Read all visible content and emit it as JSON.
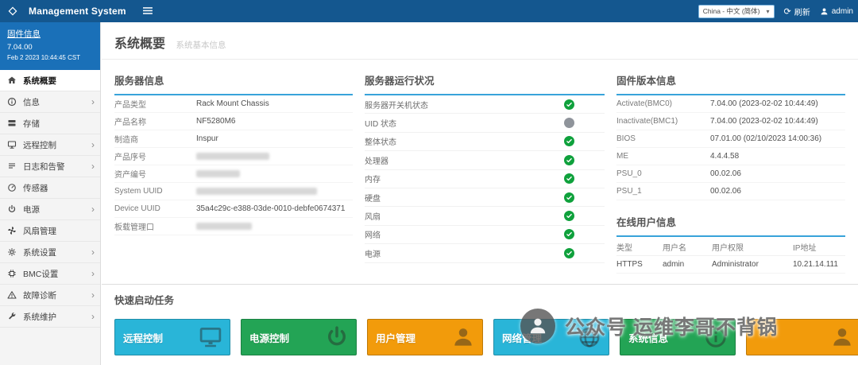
{
  "header": {
    "title": "Management System",
    "language": "China - 中文 (简体)",
    "refresh_label": "刷新",
    "user": "admin"
  },
  "sidebar": {
    "firmware_box": {
      "title": "固件信息",
      "version": "7.04.00",
      "date": "Feb 2 2023 10:44:45 CST"
    },
    "items": [
      {
        "id": "overview",
        "label": "系统概要",
        "icon": "home-icon",
        "active": true,
        "expandable": false
      },
      {
        "id": "info",
        "label": "信息",
        "icon": "info-icon",
        "active": false,
        "expandable": true
      },
      {
        "id": "storage",
        "label": "存储",
        "icon": "storage-icon",
        "active": false,
        "expandable": false
      },
      {
        "id": "remote-control",
        "label": "远程控制",
        "icon": "remote-icon",
        "active": false,
        "expandable": true
      },
      {
        "id": "logs-alerts",
        "label": "日志和告警",
        "icon": "log-icon",
        "active": false,
        "expandable": true
      },
      {
        "id": "sensors",
        "label": "传感器",
        "icon": "sensor-icon",
        "active": false,
        "expandable": false
      },
      {
        "id": "power",
        "label": "电源",
        "icon": "power-icon",
        "active": false,
        "expandable": true
      },
      {
        "id": "fan-management",
        "label": "风扇管理",
        "icon": "fan-icon",
        "active": false,
        "expandable": false
      },
      {
        "id": "system-settings",
        "label": "系统设置",
        "icon": "settings-icon",
        "active": false,
        "expandable": true
      },
      {
        "id": "bmc-settings",
        "label": "BMC设置",
        "icon": "bmc-icon",
        "active": false,
        "expandable": true
      },
      {
        "id": "fault-diagnosis",
        "label": "故障诊断",
        "icon": "diagnosis-icon",
        "active": false,
        "expandable": true
      },
      {
        "id": "system-maintenance",
        "label": "系统维护",
        "icon": "maintenance-icon",
        "active": false,
        "expandable": true
      }
    ]
  },
  "page": {
    "title": "系统概要",
    "subtitle": "系统基本信息"
  },
  "server_info": {
    "title": "服务器信息",
    "rows": [
      {
        "label": "产品类型",
        "value": "Rack Mount Chassis",
        "redacted": false
      },
      {
        "label": "产品名称",
        "value": "NF5280M6",
        "redacted": false
      },
      {
        "label": "制造商",
        "value": "Inspur",
        "redacted": false
      },
      {
        "label": "产品序号",
        "value": "",
        "redacted": true,
        "redacted_width": 92
      },
      {
        "label": "资产编号",
        "value": "",
        "redacted": true,
        "redacted_width": 55
      },
      {
        "label": "System UUID",
        "value": "",
        "redacted": true,
        "redacted_width": 152
      },
      {
        "label": "Device UUID",
        "value": "35a4c29c-e388-03de-0010-debfe0674371",
        "redacted": false
      },
      {
        "label": "板载管理口",
        "value": "",
        "redacted": true,
        "redacted_width": 70
      }
    ]
  },
  "health": {
    "title": "服务器运行状况",
    "rows": [
      {
        "label": "服务器开关机状态",
        "status": "ok"
      },
      {
        "label": "UID 状态",
        "status": "off"
      },
      {
        "label": "整体状态",
        "status": "ok"
      },
      {
        "label": "处理器",
        "status": "ok"
      },
      {
        "label": "内存",
        "status": "ok"
      },
      {
        "label": "硬盘",
        "status": "ok"
      },
      {
        "label": "风扇",
        "status": "ok"
      },
      {
        "label": "网络",
        "status": "ok"
      },
      {
        "label": "电源",
        "status": "ok"
      }
    ]
  },
  "firmware": {
    "title": "固件版本信息",
    "rows": [
      {
        "label": "Activate(BMC0)",
        "value": "7.04.00 (2023-02-02 10:44:49)"
      },
      {
        "label": "Inactivate(BMC1)",
        "value": "7.04.00 (2023-02-02 10:44:49)"
      },
      {
        "label": "BIOS",
        "value": "07.01.00 (02/10/2023 14:00:36)"
      },
      {
        "label": "ME",
        "value": "4.4.4.58"
      },
      {
        "label": "PSU_0",
        "value": "00.02.06"
      },
      {
        "label": "PSU_1",
        "value": "00.02.06"
      }
    ]
  },
  "online_users": {
    "title": "在线用户信息",
    "columns": [
      "类型",
      "用户名",
      "用户权限",
      "IP地址"
    ],
    "rows": [
      [
        "HTTPS",
        "admin",
        "Administrator",
        "10.21.14.111"
      ]
    ]
  },
  "quick_tasks": {
    "title": "快速启动任务",
    "buttons": [
      {
        "id": "remote-control",
        "label": "远程控制",
        "color": "#29b5d8",
        "icon": "monitor-icon"
      },
      {
        "id": "power-control",
        "label": "电源控制",
        "color": "#23a455",
        "icon": "task-power-icon"
      },
      {
        "id": "user-management",
        "label": "用户管理",
        "color": "#f29b0b",
        "icon": "user-icon"
      },
      {
        "id": "network-management",
        "label": "网络管理",
        "color": "#29b5d8",
        "icon": "globe-icon"
      },
      {
        "id": "system-info",
        "label": "系统信息",
        "color": "#23a455",
        "icon": "task-info-icon"
      },
      {
        "id": "task-6",
        "label": "",
        "color": "#f29b0b",
        "icon": "user-icon"
      }
    ]
  },
  "watermark": {
    "text": "公众号 运维李哥不背锅"
  },
  "colors": {
    "header_bg": "#14578f",
    "sidebar_fw_bg": "#1a70b8",
    "panel_accent": "#38a3da",
    "status_ok": "#0fa13c",
    "status_off": "#8f949b"
  }
}
